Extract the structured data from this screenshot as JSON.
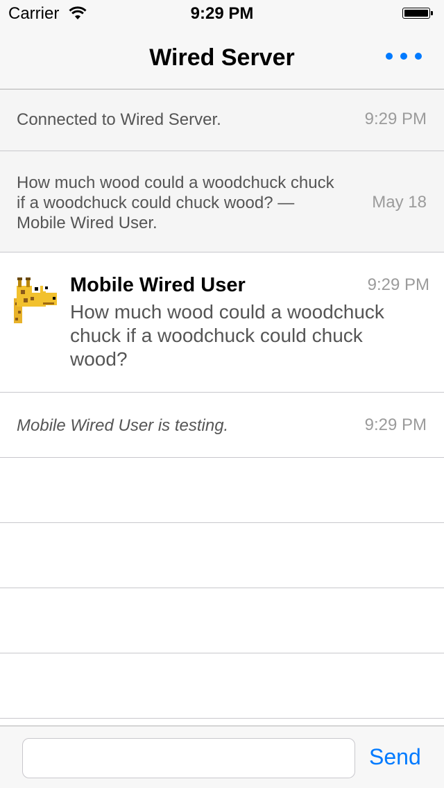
{
  "status_bar": {
    "carrier": "Carrier",
    "time": "9:29 PM"
  },
  "nav": {
    "title": "Wired Server",
    "more_icon": "ellipsis-icon",
    "accent": "#007aff"
  },
  "messages": [
    {
      "type": "event",
      "text": "Connected to Wired Server.",
      "time": "9:29 PM"
    },
    {
      "type": "topic",
      "text": "How much wood could a woodchuck chuck if a woodchuck could chuck wood? — Mobile Wired User.",
      "time": "May 18"
    },
    {
      "type": "chat",
      "avatar_icon": "giraffe-avatar-icon",
      "nick": "Mobile Wired User",
      "text": "How much wood could a woodchuck chuck if a woodchuck could chuck wood?",
      "time": "9:29 PM"
    },
    {
      "type": "action",
      "text": "Mobile Wired User is testing.",
      "time": "9:29 PM"
    }
  ],
  "composer": {
    "value": "",
    "placeholder": "",
    "send_label": "Send"
  }
}
